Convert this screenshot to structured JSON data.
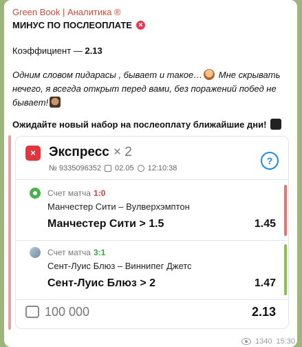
{
  "message": {
    "sender": "Green Book | Аналитика ®",
    "title": "МИНУС ПО ПОСЛЕОПЛАТЕ",
    "coef_label": "Коэффициент — ",
    "coef_value": "2.13",
    "note_part1": "Одним словом пидарасы , бывает и такое…",
    "note_part2": " Мне скрывать нечего, я всегда открыт перед вами, без поражений побед не бывает!",
    "await_text": "Ожидайте новый набор на послеоплату ближайшие дни!",
    "views": "1340",
    "time": "15:30"
  },
  "card": {
    "status_icon": "×",
    "title": "Экспресс",
    "multiplier": "× 2",
    "ticket": "№ 9335096352",
    "date": "02.05",
    "time": "12:10:38",
    "help": "?",
    "legs": [
      {
        "sport_icon": "soccer-icon",
        "score_label": "Счет матча",
        "score": "1:0",
        "score_color": "#e53935",
        "match": "Манчестер Сити – Вулверхэмптон",
        "pick": "Манчестер Сити > 1.5",
        "odd": "1.45",
        "status_color": "#e57373"
      },
      {
        "sport_icon": "hockey-puck-icon",
        "score_label": "Счет матча",
        "score": "3:1",
        "score_color": "#43a047",
        "match": "Сент-Луис Блюз – Виннипег Джетс",
        "pick": "Сент-Луис Блюз > 2",
        "odd": "1.47",
        "status_color": "#8bc34a"
      }
    ],
    "stake": "100 000",
    "total_odd": "2.13"
  }
}
